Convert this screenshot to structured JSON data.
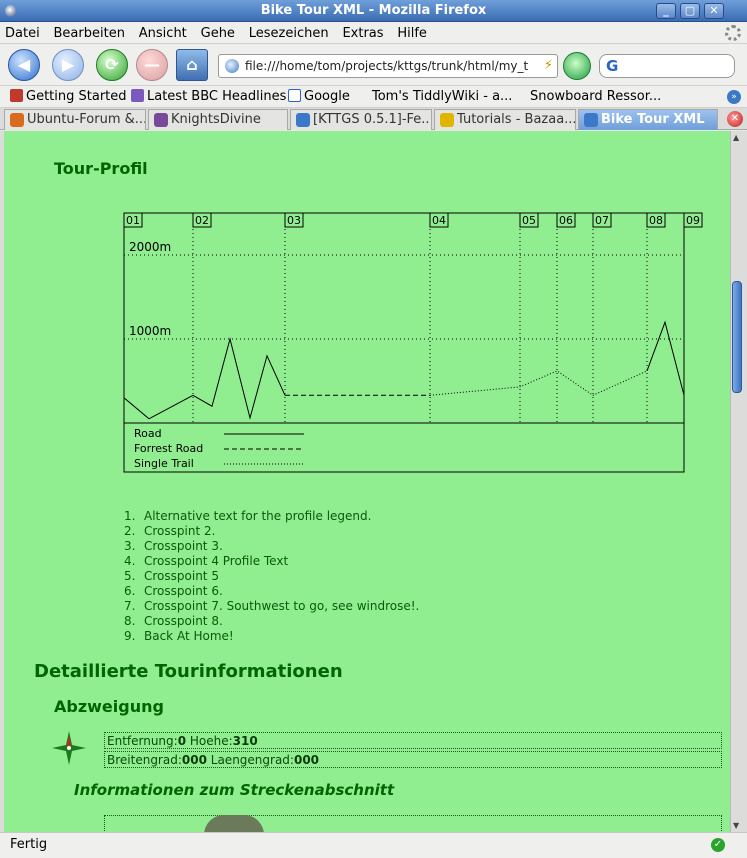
{
  "window": {
    "title": "Bike Tour XML - Mozilla Firefox"
  },
  "menu": [
    "Datei",
    "Bearbeiten",
    "Ansicht",
    "Gehe",
    "Lesezeichen",
    "Extras",
    "Hilfe"
  ],
  "navbar": {
    "url": "file:///home/tom/projects/kttgs/trunk/html/my_t"
  },
  "bookmarks": [
    {
      "label": "Getting Started",
      "icon": "getting-started-icon",
      "color": "#c0392b"
    },
    {
      "label": "Latest BBC Headlines",
      "icon": "rss-icon",
      "color": "#7a5abf"
    },
    {
      "label": "Google",
      "icon": "google-icon",
      "color": "#2a62c9"
    },
    {
      "label": "Tom's TiddlyWiki - a...",
      "icon": "",
      "color": ""
    },
    {
      "label": "Snowboard Ressor...",
      "icon": "",
      "color": ""
    }
  ],
  "tabs": [
    {
      "label": "Ubuntu-Forum &...",
      "active": false,
      "icon_color": "#d96b1e"
    },
    {
      "label": "KnightsDivine",
      "active": false,
      "icon_color": "#7a4a9a"
    },
    {
      "label": "[KTTGS 0.5.1]-Fe...",
      "active": false,
      "icon_color": "#3b79c8"
    },
    {
      "label": "Tutorials - Bazaa...",
      "active": false,
      "icon_color": "#e0b500"
    },
    {
      "label": "Bike Tour XML",
      "active": true,
      "icon_color": "#3b79c8"
    }
  ],
  "page": {
    "profile_heading": "Tour-Profil",
    "crosspoints": [
      "Alternative text for the profile legend.",
      "Crosspint 2.",
      "Crosspoint 3.",
      "Crosspoint 4 Profile Text",
      "Crosspoint 5",
      "Crosspoint 6.",
      "Crosspoint 7. Southwest to go, see windrose!.",
      "Crosspoint 8.",
      "Back At Home!"
    ],
    "details_heading": "Detaillierte Tourinformationen",
    "branch_heading": "Abzweigung",
    "info_row1": {
      "entfernung_label": "Entfernung:",
      "entfernung_value": "0",
      "hoehe_label": " Hoehe:",
      "hoehe_value": "310"
    },
    "info_row2": {
      "breitengrad_label": "Breitengrad:",
      "breitengrad_value": "000",
      "laengengrad_label": " Laengengrad:",
      "laengengrad_value": "000"
    },
    "segment_heading": "Informationen zum Streckenabschnitt"
  },
  "chart_data": {
    "type": "line",
    "x_markers": [
      "01",
      "02",
      "03",
      "04",
      "05",
      "06",
      "07",
      "08",
      "09"
    ],
    "x_marker_positions": [
      0,
      69,
      161,
      306,
      396,
      433,
      469,
      523,
      560
    ],
    "x_range": [
      0,
      560
    ],
    "y_labels": [
      "2000m",
      "1000m"
    ],
    "y_label_values": [
      2000,
      1000
    ],
    "y_range": [
      0,
      2000
    ],
    "legend": [
      {
        "label": "Road",
        "style": "solid"
      },
      {
        "label": "Forrest Road",
        "style": "dashed"
      },
      {
        "label": "Single Trail",
        "style": "dotted"
      }
    ],
    "series": [
      {
        "name": "Road",
        "style": "solid",
        "points": [
          [
            0,
            300
          ],
          [
            25,
            50
          ],
          [
            69,
            330
          ],
          [
            88,
            200
          ],
          [
            106,
            1000
          ],
          [
            126,
            60
          ],
          [
            143,
            800
          ],
          [
            161,
            330
          ]
        ]
      },
      {
        "name": "Forrest Road",
        "style": "dashed",
        "points": [
          [
            161,
            330
          ],
          [
            306,
            330
          ]
        ]
      },
      {
        "name": "Single Trail",
        "style": "dotted",
        "points": [
          [
            306,
            330
          ],
          [
            396,
            430
          ],
          [
            433,
            620
          ],
          [
            469,
            330
          ],
          [
            523,
            620
          ]
        ]
      },
      {
        "name": "Road",
        "style": "solid",
        "points": [
          [
            523,
            620
          ],
          [
            541,
            1200
          ],
          [
            560,
            330
          ]
        ]
      }
    ]
  },
  "statusbar": {
    "text": "Fertig"
  },
  "colors": {
    "page_bg": "#90ee90",
    "heading": "#006400",
    "accent": "#3a6cb6"
  }
}
